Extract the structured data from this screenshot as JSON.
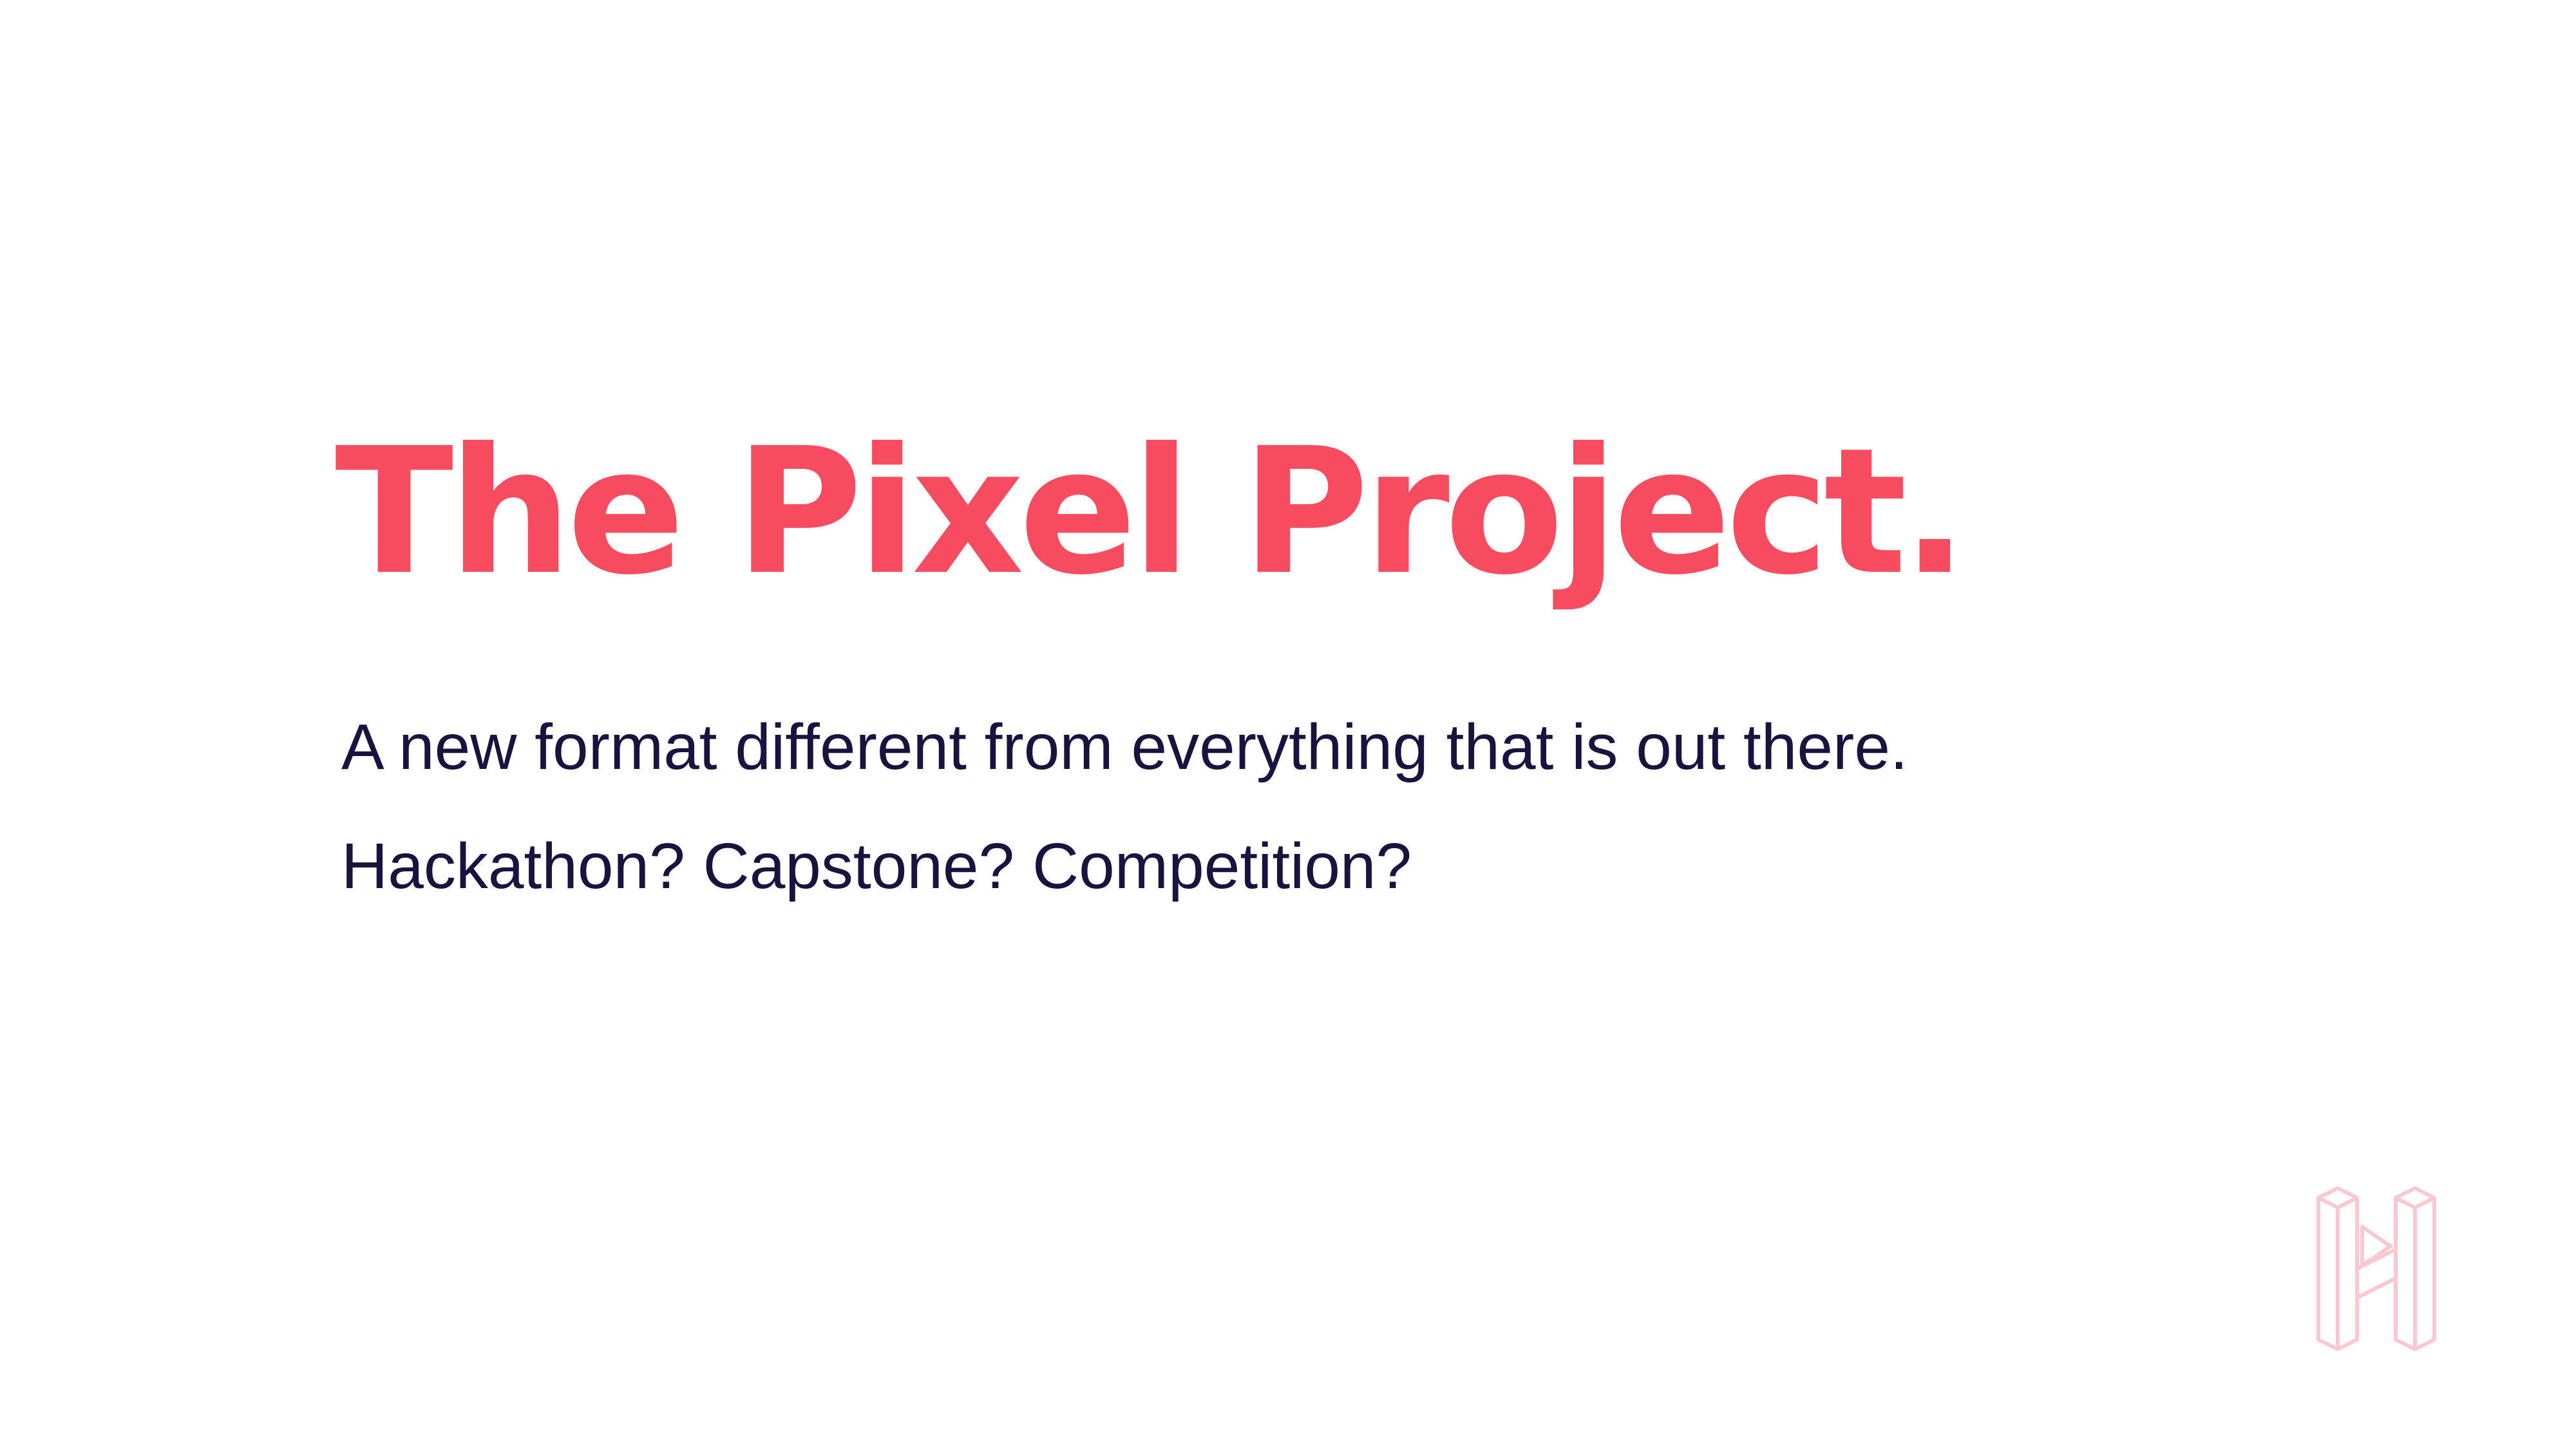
{
  "slide": {
    "title": "The Pixel Project.",
    "lines": [
      "A new format different from everything that is out there.",
      "Hackathon? Capstone? Competition?"
    ],
    "logo_icon": "isometric-h-play-logo-icon"
  },
  "colors": {
    "title": "#F74B5F",
    "body_text": "#1A1340",
    "logo_stroke": "#F9C9CF",
    "background": "#FFFFFF"
  }
}
